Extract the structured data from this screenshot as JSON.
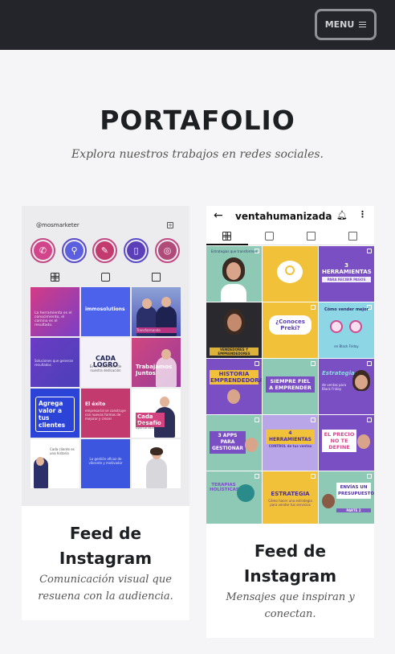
{
  "header": {
    "menu_label": "MENU"
  },
  "section": {
    "title": "PORTAFOLIO",
    "subtitle": "Explora nuestros trabajos en redes sociales."
  },
  "cards": [
    {
      "title_line1": "Feed de",
      "title_line2": "Instagram",
      "desc_line1": "Comunicación visual que",
      "desc_line2": "resuena con la audiencia.",
      "shot": {
        "username": "@mosmarketer",
        "highlight_icons": [
          "whatsapp-icon",
          "link-icon",
          "document-icon",
          "mobile-icon",
          "globe-icon"
        ],
        "tiles": [
          {
            "title": "",
            "sub": "La herramienta es el conocimiento, el camino es el resultado."
          },
          {
            "title": "immosolutions",
            "sub": ""
          },
          {
            "title": "",
            "sub": "Transformando"
          },
          {
            "title": "",
            "sub": "Soluciones que generan resultados"
          },
          {
            "title": "CADA LOGRO",
            "sub": "Es un testimonio de nuestra dedicación"
          },
          {
            "title": "Trabajamos Juntos",
            "sub": "Para adaptarnos a tus necesidades"
          },
          {
            "title": "Agrega valor a tus clientes",
            "sub": ""
          },
          {
            "title": "El éxito",
            "sub": "empresarial se construye con nuevas formas de mejorar y crecer"
          },
          {
            "title": "Cada Desafío",
            "sub": "es una oportunidad"
          },
          {
            "title": "",
            "sub": "Cada cliente es una historia"
          },
          {
            "title": "",
            "sub": "La gestión eficaz de vibrante y motivador"
          },
          {
            "title": "",
            "sub": ""
          }
        ]
      }
    },
    {
      "title_line1": "Feed de",
      "title_line2": "Instagram",
      "desc_line1": "Mensajes que inspiran y",
      "desc_line2": "conectan.",
      "shot": {
        "username": "ventahumanizada",
        "tiles": [
          {
            "title": "",
            "sub": "Estrategias que transforman"
          },
          {
            "title": "",
            "sub": ""
          },
          {
            "title": "3 HERRAMIENTAS",
            "sub": "PARA RECIBIR PAGOS"
          },
          {
            "title": "",
            "sub": "VENDEDORES Y EMPRENDEDORES"
          },
          {
            "title": "¿Conoces Prekí?",
            "sub": ""
          },
          {
            "title": "Cómo vender mejor",
            "sub": "en Black Friday"
          },
          {
            "title": "HISTORIA EMPRENDEDORA",
            "sub": ""
          },
          {
            "title": "SIEMPRE FIEL A EMPRENDER",
            "sub": ""
          },
          {
            "title": "Estrategia",
            "sub": "de ventas para Black Friday"
          },
          {
            "title": "3 APPS PARA GESTIONAR",
            "sub": ""
          },
          {
            "title": "4 HERRAMIENTAS",
            "sub": "CONTROL de tus ventas"
          },
          {
            "title": "EL PRECIO NO TE DEFINE",
            "sub": ""
          },
          {
            "title": "TERAPIAS HOLÍSTICAS",
            "sub": ""
          },
          {
            "title": "ESTRATEGIA",
            "sub": "Cómo hacer una estrategia para vender tus servicios"
          },
          {
            "title": "ENVÍAS UN PRESUPUESTO",
            "sub": "PARTE 2"
          }
        ]
      }
    }
  ]
}
